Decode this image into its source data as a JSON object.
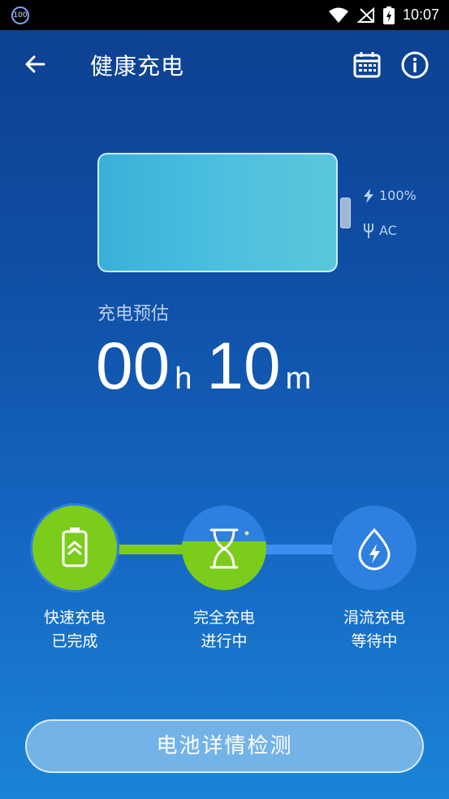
{
  "status_bar": {
    "badge": "100",
    "time": "10:07"
  },
  "app_bar": {
    "title": "健康充电"
  },
  "battery": {
    "percent": "100%",
    "source": "AC",
    "level": 1.0
  },
  "estimate": {
    "label": "充电预估",
    "hours": "00",
    "hours_unit": "h",
    "minutes": "10",
    "minutes_unit": "m"
  },
  "steps": [
    {
      "line1": "快速充电",
      "line2": "已完成",
      "icon": "battery-fast-charge-icon",
      "state": "done"
    },
    {
      "line1": "完全充电",
      "line2": "进行中",
      "icon": "hourglass-icon",
      "state": "in-progress"
    },
    {
      "line1": "涓流充电",
      "line2": "等待中",
      "icon": "trickle-drop-icon",
      "state": "waiting"
    }
  ],
  "bottom_button": {
    "label": "电池详情检测"
  },
  "colors": {
    "done_green": "#7ccc1c",
    "pending_blue": "#2d7fe0"
  }
}
